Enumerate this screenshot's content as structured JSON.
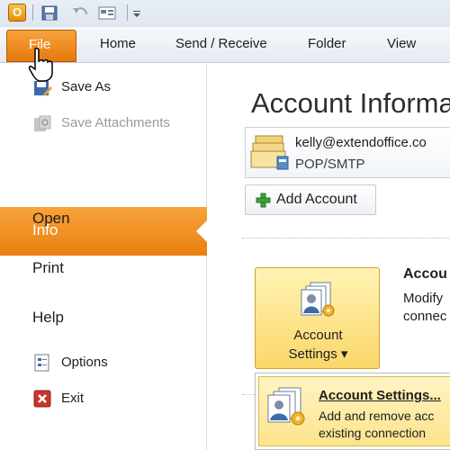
{
  "app": {
    "logo_letter": "O"
  },
  "ribbon": {
    "file_tab": "File",
    "tabs": [
      "Home",
      "Send / Receive",
      "Folder",
      "View"
    ]
  },
  "nav": {
    "save_as": "Save As",
    "save_attachments": "Save Attachments",
    "info": "Info",
    "open": "Open",
    "print": "Print",
    "help": "Help",
    "options": "Options",
    "exit": "Exit"
  },
  "main": {
    "title": "Account Informa",
    "account": {
      "email": "kelly@extendoffice.co",
      "type": "POP/SMTP"
    },
    "add_account": "Add Account",
    "account_settings": {
      "label_line1": "Account",
      "label_line2": "Settings ▾",
      "heading": "Accou",
      "desc_line1": "Modify",
      "desc_line2": "connec"
    }
  },
  "dropdown": {
    "item_title": "Account Settings...",
    "item_desc_line1": "Add and remove acc",
    "item_desc_line2": "existing connection"
  },
  "colors": {
    "accent": "#f29423",
    "file_tab": "#e6780d",
    "highlight": "#fde38c"
  },
  "icons": [
    "outlook-logo-icon",
    "save-icon",
    "undo-icon",
    "quick-access-icon",
    "customize-arrow-icon",
    "hand-cursor-icon",
    "save-as-icon",
    "save-attachments-icon",
    "options-icon",
    "exit-icon",
    "mailbox-icon",
    "add-icon",
    "account-settings-icon"
  ]
}
